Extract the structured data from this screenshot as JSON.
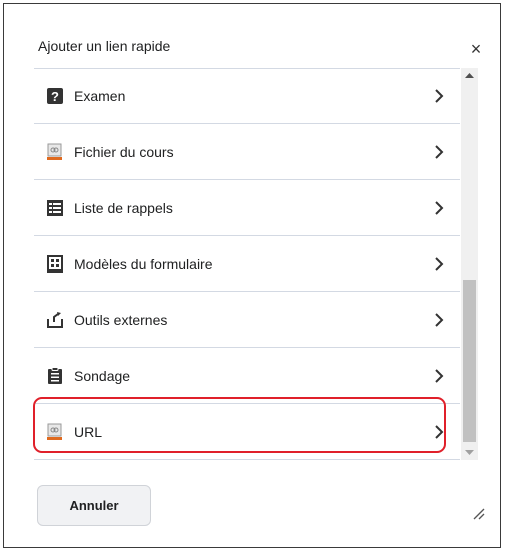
{
  "dialog": {
    "title": "Ajouter un lien rapide",
    "close_label": "×"
  },
  "items": [
    {
      "label": "Examen",
      "icon": "question-box-icon"
    },
    {
      "label": "Fichier du cours",
      "icon": "course-file-icon"
    },
    {
      "label": "Liste de rappels",
      "icon": "checklist-icon"
    },
    {
      "label": "Modèles du formulaire",
      "icon": "form-template-icon"
    },
    {
      "label": "Outils externes",
      "icon": "external-tools-icon"
    },
    {
      "label": "Sondage",
      "icon": "survey-clipboard-icon"
    },
    {
      "label": "URL",
      "icon": "url-link-icon"
    }
  ],
  "footer": {
    "cancel_label": "Annuler"
  },
  "colors": {
    "highlight": "#e0202a",
    "divider": "#d3d9e3",
    "button_bg": "#f1f2f4"
  }
}
